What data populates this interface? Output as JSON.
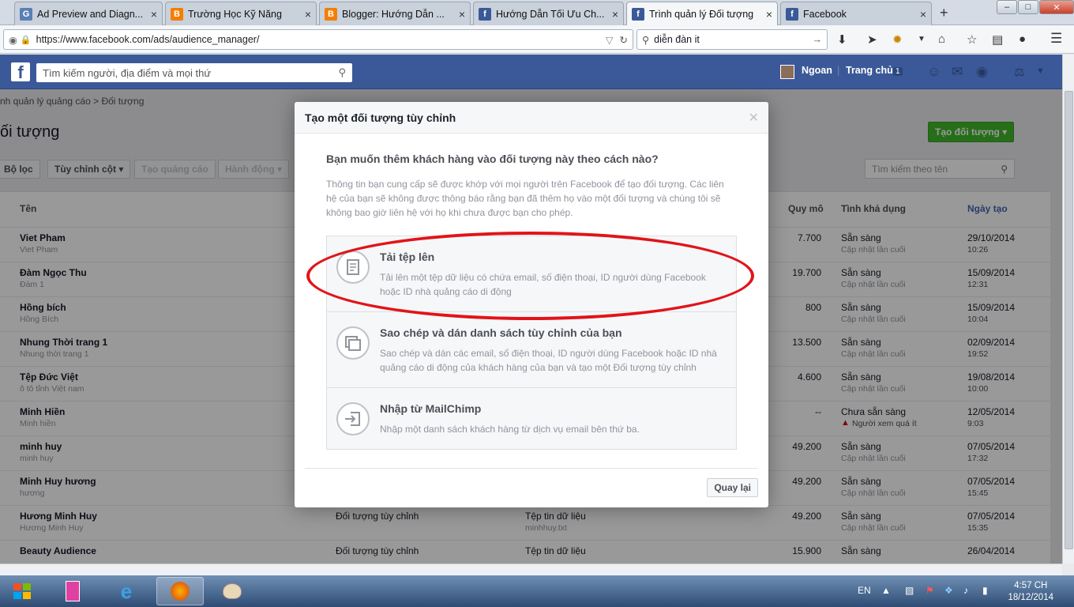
{
  "browser": {
    "tabs": [
      {
        "label": "Ad Preview and Diagn...",
        "fav": "G",
        "favcolor": "#5a7fb5"
      },
      {
        "label": "Trường Học Kỹ Năng",
        "fav": "B",
        "favcolor": "#f57d00"
      },
      {
        "label": "Blogger: Hướng Dẫn ...",
        "fav": "B",
        "favcolor": "#f57d00"
      },
      {
        "label": "Hướng Dẫn Tối Ưu Ch...",
        "fav": "f",
        "favcolor": "#3b5998"
      },
      {
        "label": "Trình quản lý Đối tượng",
        "fav": "f",
        "favcolor": "#3b5998",
        "active": true
      },
      {
        "label": "Facebook",
        "fav": "f",
        "favcolor": "#3b5998"
      }
    ],
    "url": "https://www.facebook.com/ads/audience_manager/",
    "search_value": "diễn đàn it"
  },
  "fb": {
    "search_placeholder": "Tìm kiếm người, địa điểm và mọi thứ",
    "user_name": "Ngoan",
    "home_label": "Trang chủ",
    "home_count": "1"
  },
  "page": {
    "breadcrumb": "nh quản lý quảng cáo  >  Đối tượng",
    "title": "ối tượng",
    "filter_label": "Bộ lọc",
    "columns_label": "Tùy chỉnh cột",
    "create_ad_label": "Tạo quảng cáo",
    "actions_label": "Hành động",
    "create_audience_label": "Tạo đối tượng",
    "search_name_placeholder": "Tìm kiếm theo tên",
    "headers": {
      "name": "Tên",
      "size": "Quy mô",
      "availability": "Tình khả dụng",
      "created": "Ngày tạo"
    },
    "rows": [
      {
        "name": "Viet Pham",
        "sub": "Viet Pham",
        "type": "",
        "src": "",
        "src2": "",
        "size": "7.700",
        "avail": "Sẵn sàng",
        "avail2": "Cập nhật lần cuối",
        "date": "29/10/2014",
        "time": "10:26"
      },
      {
        "name": "Đàm Ngọc Thu",
        "sub": "Đàm 1",
        "type": "",
        "src": "",
        "src2": "",
        "size": "19.700",
        "avail": "Sẵn sàng",
        "avail2": "Cập nhật lần cuối",
        "date": "15/09/2014",
        "time": "12:31"
      },
      {
        "name": "Hồng bích",
        "sub": "Hồng Bích",
        "type": "",
        "src": "",
        "src2": "",
        "size": "800",
        "avail": "Sẵn sàng",
        "avail2": "Cập nhật lần cuối",
        "date": "15/09/2014",
        "time": "10:04"
      },
      {
        "name": "Nhung Thời trang 1",
        "sub": "Nhung thời trang 1",
        "type": "",
        "src": "",
        "src2": "",
        "size": "13.500",
        "avail": "Sẵn sàng",
        "avail2": "Cập nhật lần cuối",
        "date": "02/09/2014",
        "time": "19:52"
      },
      {
        "name": "Tệp Đức Việt",
        "sub": "ô tô tỉnh Việt nam",
        "type": "",
        "src": "",
        "src2": "",
        "size": "4.600",
        "avail": "Sẵn sàng",
        "avail2": "Cập nhật lần cuối",
        "date": "19/08/2014",
        "time": "10:00"
      },
      {
        "name": "Minh Hiền",
        "sub": "Minh hiền",
        "type": "",
        "src": "",
        "src2": "",
        "size": "--",
        "avail": "Chưa sẵn sàng",
        "avail2": "Người xem quá ít",
        "date": "12/05/2014",
        "time": "9:03",
        "warn": true
      },
      {
        "name": "minh huy",
        "sub": "minh huy",
        "type": "",
        "src": "",
        "src2": "",
        "size": "49.200",
        "avail": "Sẵn sàng",
        "avail2": "Cập nhật lần cuối",
        "date": "07/05/2014",
        "time": "17:32"
      },
      {
        "name": "Minh Huy hương",
        "sub": "hương",
        "type": "",
        "src": "",
        "src2": "",
        "size": "49.200",
        "avail": "Sẵn sàng",
        "avail2": "Cập nhật lần cuối",
        "date": "07/05/2014",
        "time": "15:45"
      },
      {
        "name": "Hương Minh Huy",
        "sub": "Hương Minh Huy",
        "type": "Đối tượng tùy chỉnh",
        "src": "Tệp tin dữ liệu",
        "src2": "minhhuy.txt",
        "size": "49.200",
        "avail": "Sẵn sàng",
        "avail2": "Cập nhật lần cuối",
        "date": "07/05/2014",
        "time": "15:35"
      },
      {
        "name": "Beauty Audience",
        "sub": "",
        "type": "Đối tượng tùy chỉnh",
        "src": "Tệp tin dữ liệu",
        "src2": "",
        "size": "15.900",
        "avail": "Sẵn sàng",
        "avail2": "",
        "date": "26/04/2014",
        "time": ""
      }
    ]
  },
  "modal": {
    "title": "Tạo một đối tượng tùy chỉnh",
    "question": "Bạn muốn thêm khách hàng vào đối tượng này theo cách nào?",
    "info": "Thông tin bạn cung cấp sẽ được khớp với mọi người trên Facebook để tạo đối tượng. Các liên hệ của bạn sẽ không được thông báo rằng bạn đã thêm họ vào một đối tượng và chúng tôi sẽ không bao giờ liên hệ với họ khi chưa được bạn cho phép.",
    "options": [
      {
        "title": "Tải tệp lên",
        "desc": "Tải lên một tệp dữ liệu có chứa email, số điện thoại, ID người dùng Facebook hoặc ID nhà quảng cáo di động",
        "icon": "file-icon"
      },
      {
        "title": "Sao chép và dán danh sách tùy chỉnh của bạn",
        "desc": "Sao chép và dán các email, số điện thoại, ID người dùng Facebook hoặc ID nhà quảng cáo di động của khách hàng của bạn và tạo một Đối tượng tùy chỉnh",
        "icon": "copy-icon"
      },
      {
        "title": "Nhập từ MailChimp",
        "desc": "Nhập một danh sách khách hàng từ dịch vụ email bên thứ ba.",
        "icon": "import-icon"
      }
    ],
    "back_label": "Quay lại"
  },
  "taskbar": {
    "lang": "EN",
    "time": "4:57 CH",
    "date": "18/12/2014"
  },
  "colors": {
    "fb_blue": "#3b5998",
    "green": "#42b72a",
    "highlight_red": "#e11418"
  }
}
